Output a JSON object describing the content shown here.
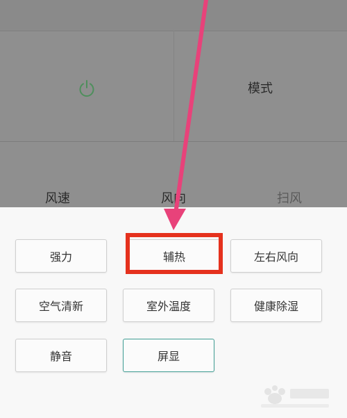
{
  "remote": {
    "power_icon": "power-icon",
    "mode_label": "模式",
    "bottom": [
      "风速",
      "风向",
      "扫风"
    ]
  },
  "options": [
    {
      "label": "强力",
      "selected": false
    },
    {
      "label": "辅热",
      "selected": false
    },
    {
      "label": "左右风向",
      "selected": false
    },
    {
      "label": "空气清新",
      "selected": false
    },
    {
      "label": "室外温度",
      "selected": false
    },
    {
      "label": "健康除湿",
      "selected": false
    },
    {
      "label": "静音",
      "selected": false
    },
    {
      "label": "屏显",
      "selected": true
    }
  ],
  "annotation": {
    "arrow_color": "#e8427a",
    "box_color": "#e5311d"
  },
  "colors": {
    "power_green": "#4e8f5c",
    "selected_border": "#3f9e94"
  }
}
